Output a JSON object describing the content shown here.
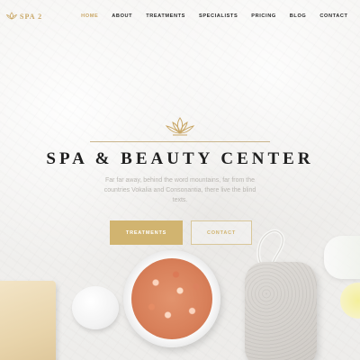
{
  "brand": {
    "logo_text": "SPA 2",
    "accent": "#c9a766"
  },
  "nav": {
    "items": [
      {
        "label": "HOME",
        "active": true
      },
      {
        "label": "ABOUT",
        "active": false
      },
      {
        "label": "TREATMENTS",
        "active": false
      },
      {
        "label": "SPECIALISTS",
        "active": false
      },
      {
        "label": "PRICING",
        "active": false
      },
      {
        "label": "BLOG",
        "active": false
      },
      {
        "label": "CONTACT",
        "active": false
      }
    ]
  },
  "hero": {
    "icon": "lotus-icon",
    "title": "SPA & BEAUTY CENTER",
    "text": "Far far away, behind the word mountains, far from the countries Vokalia and Consonantia, there live the blind texts.",
    "buttons": {
      "treatments": "TREATMENTS",
      "contact": "CONTACT"
    }
  }
}
